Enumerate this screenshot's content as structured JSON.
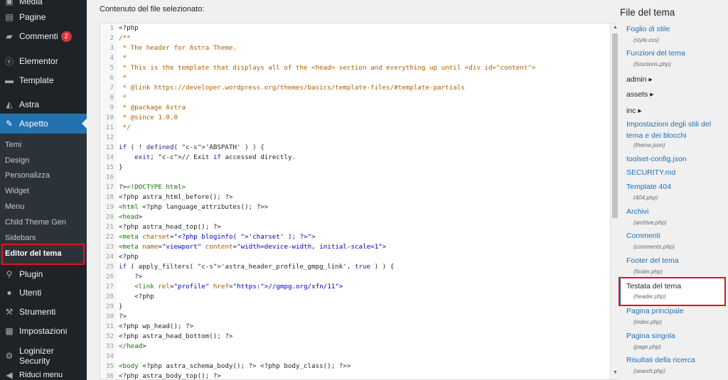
{
  "sidebar": {
    "items": [
      {
        "label": "Media",
        "icon": "media-icon"
      },
      {
        "label": "Pagine",
        "icon": "pages-icon"
      },
      {
        "label": "Commenti",
        "icon": "comments-icon",
        "badge": "2"
      },
      {
        "label": "Elementor",
        "icon": "elementor-icon"
      },
      {
        "label": "Template",
        "icon": "template-folder-icon"
      },
      {
        "label": "Astra",
        "icon": "astra-icon"
      },
      {
        "label": "Aspetto",
        "icon": "appearance-brush-icon"
      },
      {
        "label": "Plugin",
        "icon": "plugin-icon"
      },
      {
        "label": "Utenti",
        "icon": "users-icon"
      },
      {
        "label": "Strumenti",
        "icon": "tools-wrench-icon"
      },
      {
        "label": "Impostazioni",
        "icon": "settings-icon"
      },
      {
        "label": "Loginizer Security",
        "icon": "gear-icon"
      },
      {
        "label": "Riduci menu",
        "icon": "collapse-menu-icon"
      }
    ],
    "submenu": [
      "Temi",
      "Design",
      "Personalizza",
      "Widget",
      "Menu",
      "Child Theme Gen",
      "Sidebars",
      "Editor del tema"
    ]
  },
  "editor": {
    "label": "Contenuto del file selezionato:",
    "lines": [
      "<?php",
      "/**",
      " * The header for Astra Theme.",
      " *",
      " * This is the template that displays all of the <head> section and everything up until <div id=\"content\">",
      " *",
      " * @link https://developer.wordpress.org/themes/basics/template-files/#template-partials",
      " *",
      " * @package Astra",
      " * @since 1.0.0",
      " */",
      "",
      "if ( ! defined( 'ABSPATH' ) ) {",
      "    exit; // Exit if accessed directly.",
      "}",
      "",
      "?><!DOCTYPE html>",
      "<?php astra_html_before(); ?>",
      "<html <?php language_attributes(); ?>>",
      "<head>",
      "<?php astra_head_top(); ?>",
      "<meta charset=\"<?php bloginfo( 'charset' ); ?>\">",
      "<meta name=\"viewport\" content=\"width=device-width, initial-scale=1\">",
      "<?php",
      "if ( apply_filters( 'astra_header_profile_gmpg_link', true ) ) {",
      "    ?>",
      "    <link rel=\"profile\" href=\"https://gmpg.org/xfn/11\">",
      "    <?php",
      "}",
      "?>",
      "<?php wp_head(); ?>",
      "<?php astra_head_bottom(); ?>",
      "</head>",
      "",
      "<body <?php astra_schema_body(); ?> <?php body_class(); ?>>",
      "<?php astra_body_top(); ?>"
    ]
  },
  "files": {
    "title": "File del tema",
    "entries": [
      {
        "name": "Foglio di stile",
        "sub": "(style.css)",
        "type": "file"
      },
      {
        "name": "Funzioni del tema",
        "sub": "(functions.php)",
        "type": "file"
      },
      {
        "name": "admin ▸",
        "type": "folder"
      },
      {
        "name": "assets ▸",
        "type": "folder"
      },
      {
        "name": "inc ▸",
        "type": "folder"
      },
      {
        "name": "Impostazioni degli stili del tema e dei blocchi",
        "sub": "(theme.json)",
        "type": "file"
      },
      {
        "name": "toolset-config.json",
        "type": "file"
      },
      {
        "name": "SECURITY.md",
        "type": "file"
      },
      {
        "name": "Template 404",
        "sub": "(404.php)",
        "type": "file"
      },
      {
        "name": "Archivi",
        "sub": "(archive.php)",
        "type": "file"
      },
      {
        "name": "Commenti",
        "sub": "(comments.php)",
        "type": "file"
      },
      {
        "name": "Footer del tema",
        "sub": "(footer.php)",
        "type": "file"
      },
      {
        "name": "Testata del tema",
        "sub": "(header.php)",
        "type": "file",
        "selected": true
      },
      {
        "name": "Pagina principale",
        "sub": "(index.php)",
        "type": "file"
      },
      {
        "name": "Pagina singola",
        "sub": "(page.php)",
        "type": "file"
      },
      {
        "name": "Risultati della ricerca",
        "sub": "(search.php)",
        "type": "file"
      }
    ]
  },
  "colors": {
    "sidebar_bg": "#1d2327",
    "active_bg": "#2271b1",
    "link": "#2271b1",
    "highlight_box": "#e0141e"
  }
}
